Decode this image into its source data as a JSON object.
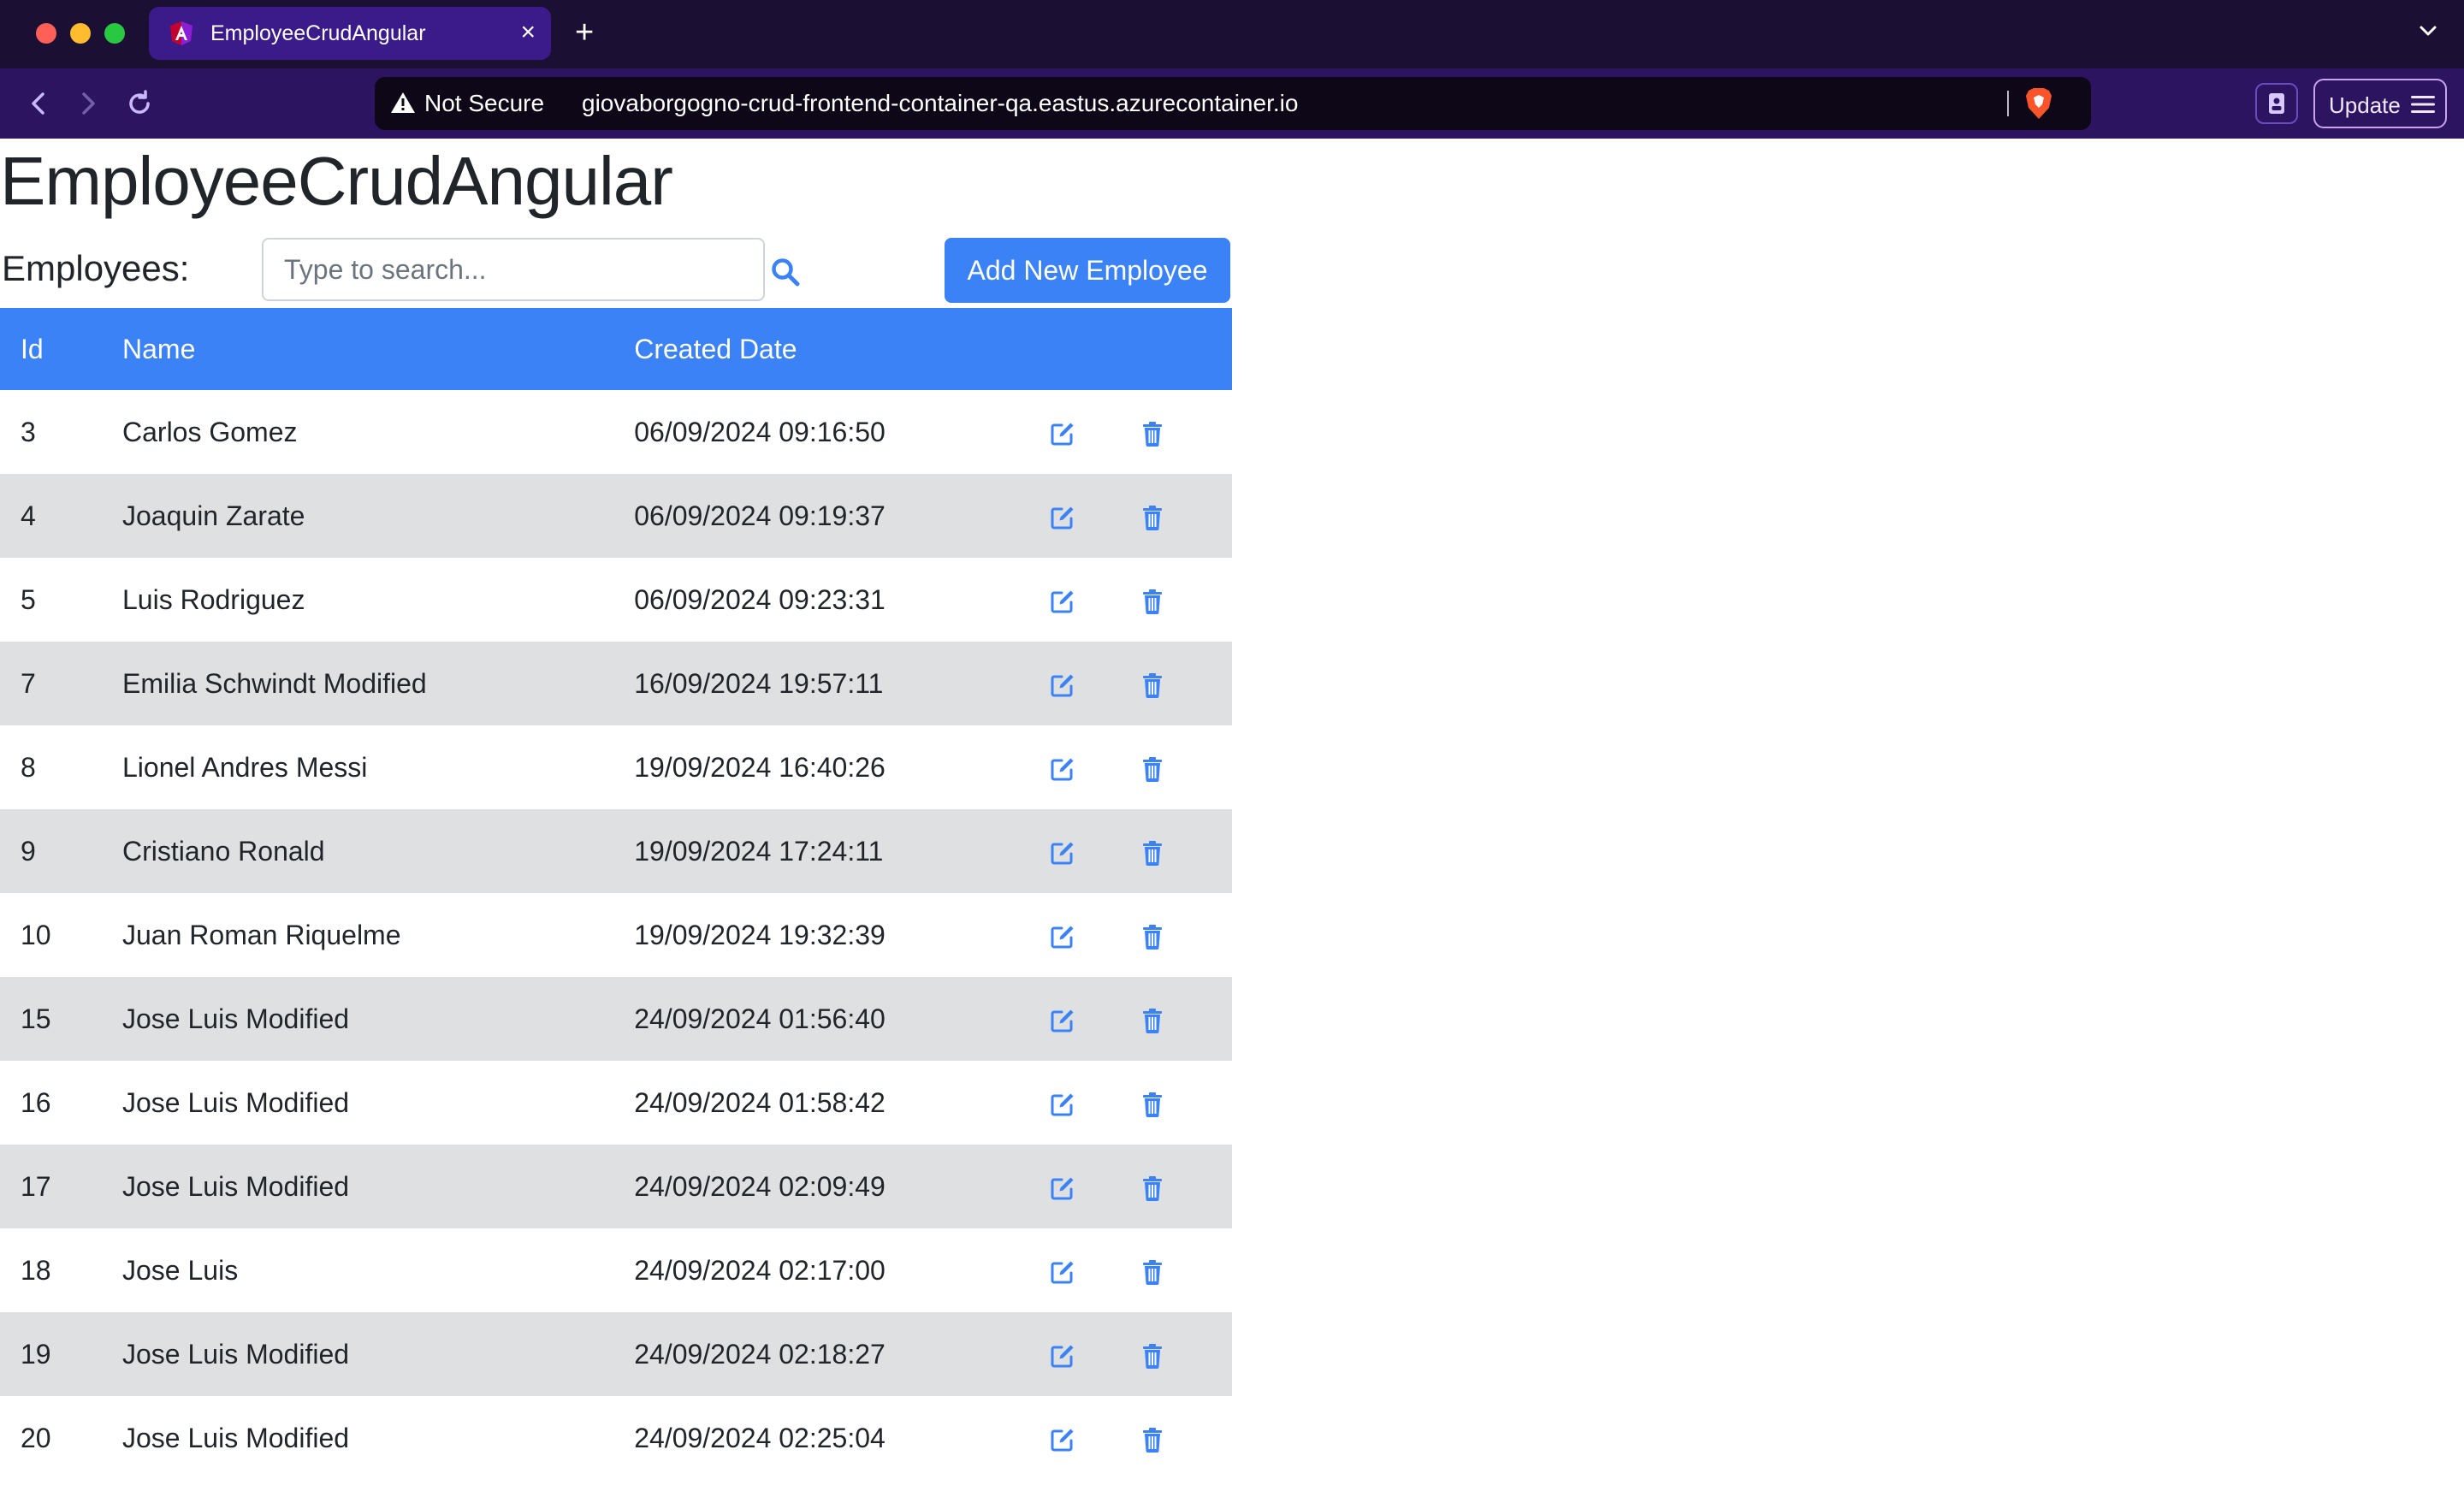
{
  "browser": {
    "tab_title": "EmployeeCrudAngular",
    "tab_close": "×",
    "new_tab": "+",
    "not_secure": "Not Secure",
    "url": "giovaborgogno-crud-frontend-container-qa.eastus.azurecontainer.io",
    "update_label": "Update"
  },
  "page": {
    "title": "EmployeeCrudAngular",
    "employees_label": "Employees:",
    "search_placeholder": "Type to search...",
    "add_button": "Add New Employee"
  },
  "table": {
    "headers": {
      "id": "Id",
      "name": "Name",
      "created": "Created Date"
    },
    "rows": [
      {
        "id": "3",
        "name": "Carlos Gomez",
        "created": "06/09/2024 09:16:50"
      },
      {
        "id": "4",
        "name": "Joaquin Zarate",
        "created": "06/09/2024 09:19:37"
      },
      {
        "id": "5",
        "name": "Luis Rodriguez",
        "created": "06/09/2024 09:23:31"
      },
      {
        "id": "7",
        "name": "Emilia Schwindt Modified",
        "created": "16/09/2024 19:57:11"
      },
      {
        "id": "8",
        "name": "Lionel Andres Messi",
        "created": "19/09/2024 16:40:26"
      },
      {
        "id": "9",
        "name": "Cristiano Ronald",
        "created": "19/09/2024 17:24:11"
      },
      {
        "id": "10",
        "name": "Juan Roman Riquelme",
        "created": "19/09/2024 19:32:39"
      },
      {
        "id": "15",
        "name": "Jose Luis Modified",
        "created": "24/09/2024 01:56:40"
      },
      {
        "id": "16",
        "name": "Jose Luis Modified",
        "created": "24/09/2024 01:58:42"
      },
      {
        "id": "17",
        "name": "Jose Luis Modified",
        "created": "24/09/2024 02:09:49"
      },
      {
        "id": "18",
        "name": "Jose Luis",
        "created": "24/09/2024 02:17:00"
      },
      {
        "id": "19",
        "name": "Jose Luis Modified",
        "created": "24/09/2024 02:18:27"
      },
      {
        "id": "20",
        "name": "Jose Luis Modified",
        "created": "24/09/2024 02:25:04"
      }
    ],
    "row_icons": {
      "edit": "edit-icon",
      "delete": "trash-icon"
    }
  },
  "colors": {
    "primary": "#3b82f6",
    "row_alt": "#dfe0e1",
    "browser_tabbar": "#1b0f33",
    "browser_toolbar": "#2d1460"
  }
}
